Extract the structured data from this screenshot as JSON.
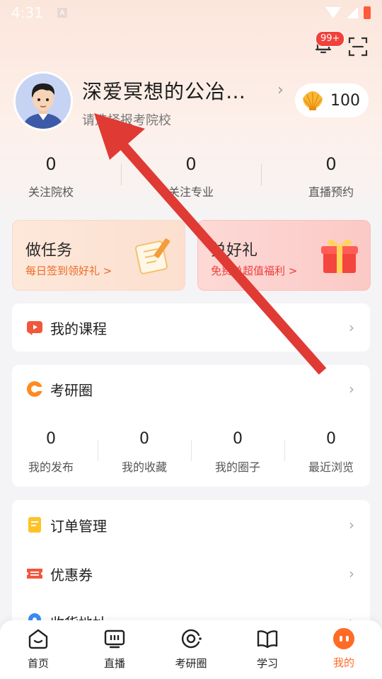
{
  "status_bar": {
    "time": "4:31",
    "indicator": "A"
  },
  "header": {
    "notification_badge": "99+"
  },
  "profile": {
    "username": "深爱冥想的公冶…",
    "school_prompt": "请选择报考院校",
    "coins": "100"
  },
  "stats": [
    {
      "value": "0",
      "label": "关注院校"
    },
    {
      "value": "0",
      "label": "关注专业"
    },
    {
      "value": "0",
      "label": "直播预约"
    }
  ],
  "cards": {
    "task": {
      "title": "做任务",
      "subtitle": "每日签到领好礼 >"
    },
    "gift": {
      "title": "兑好礼",
      "subtitle": "免费兑超值福利 >"
    }
  },
  "menu": {
    "my_courses": "我的课程",
    "circle": "考研圈",
    "orders": "订单管理",
    "coupons": "优惠券",
    "address": "收货地址"
  },
  "circle_stats": [
    {
      "value": "0",
      "label": "我的发布"
    },
    {
      "value": "0",
      "label": "我的收藏"
    },
    {
      "value": "0",
      "label": "我的圈子"
    },
    {
      "value": "0",
      "label": "最近浏览"
    }
  ],
  "tabs": [
    {
      "label": "首页",
      "icon": "home-icon"
    },
    {
      "label": "直播",
      "icon": "live-tv-icon"
    },
    {
      "label": "考研圈",
      "icon": "circle-community-icon"
    },
    {
      "label": "学习",
      "icon": "open-book-icon"
    },
    {
      "label": "我的",
      "icon": "profile-dot-icon"
    }
  ],
  "colors": {
    "accent": "#ff6a26",
    "badge": "#f0413b",
    "annotation_arrow": "#e03a35"
  }
}
